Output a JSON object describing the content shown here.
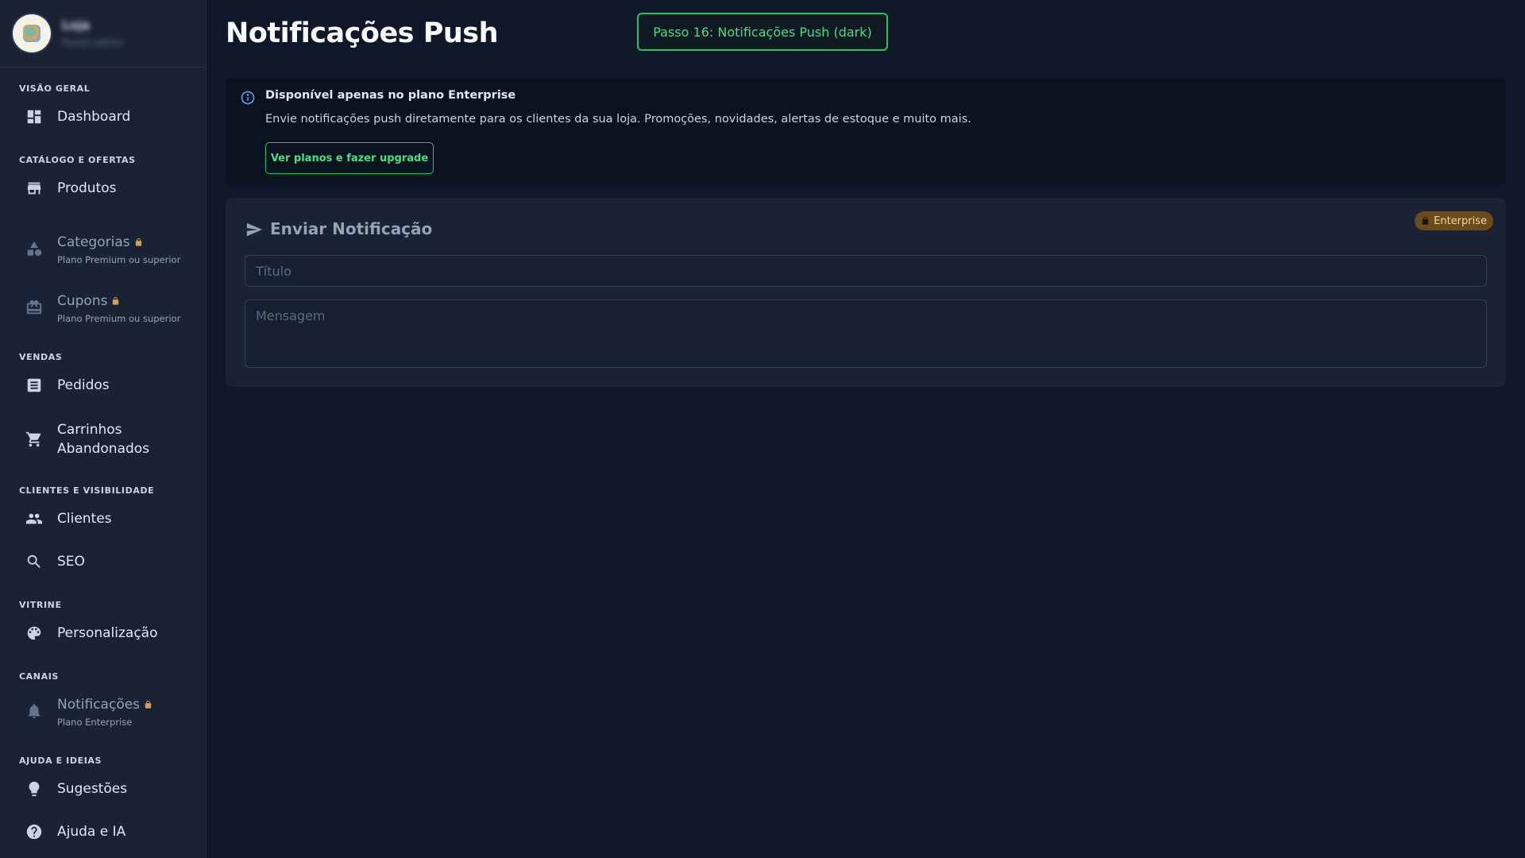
{
  "brand": {
    "name": "Loja",
    "subtitle": "Painel admin"
  },
  "sidebar": {
    "sections": [
      {
        "title": "Visão Geral",
        "items": [
          {
            "label": "Dashboard",
            "icon": "dashboard-icon"
          }
        ]
      },
      {
        "title": "Catálogo e Ofertas",
        "items": [
          {
            "label": "Produtos",
            "icon": "archive-box-icon"
          },
          {
            "label": "Categorias",
            "icon": "category-shapes-icon",
            "locked": true,
            "sub": "Plano Premium ou superior"
          },
          {
            "label": "Cupons",
            "icon": "gift-card-icon",
            "locked": true,
            "sub": "Plano Premium ou superior"
          }
        ]
      },
      {
        "title": "Vendas",
        "items": [
          {
            "label": "Pedidos",
            "icon": "receipt-list-icon"
          },
          {
            "label": "Carrinhos Abandonados",
            "label_line1": "Carrinhos",
            "label_line2": "Abandonados",
            "icon": "shopping-cart-icon"
          }
        ]
      },
      {
        "title": "Clientes e Visibilidade",
        "items": [
          {
            "label": "Clientes",
            "icon": "people-icon"
          },
          {
            "label": "SEO",
            "icon": "search-icon"
          }
        ]
      },
      {
        "title": "Vitrine",
        "items": [
          {
            "label": "Personalização",
            "icon": "palette-icon"
          }
        ]
      },
      {
        "title": "Canais",
        "items": [
          {
            "label": "Notificações",
            "icon": "bell-icon",
            "locked": true,
            "sub": "Plano Enterprise"
          }
        ]
      },
      {
        "title": "Ajuda e Ideias",
        "items": [
          {
            "label": "Sugestões",
            "icon": "lightbulb-icon"
          },
          {
            "label": "Ajuda e IA",
            "icon": "help-circle-icon"
          }
        ]
      }
    ]
  },
  "page": {
    "title": "Notificações Push",
    "step_badge": "Passo 16: Notificações Push (dark)"
  },
  "info": {
    "icon": "info-circle-icon",
    "title": "Disponível apenas no plano Enterprise",
    "text": "Envie notificações push diretamente para os clientes da sua loja. Promoções, novidades, alertas de estoque e muito mais.",
    "button": "Ver planos e fazer upgrade"
  },
  "send": {
    "icon": "send-icon",
    "title": "Enviar Notificação",
    "badge": "Enterprise",
    "title_placeholder": "Título",
    "title_value": "",
    "message_placeholder": "Mensagem",
    "message_value": ""
  },
  "colors": {
    "background": "#0f172a",
    "sidebar": "#1a2335",
    "accent_green": "#22c55e",
    "info_blue": "#60a5fa",
    "lock_amber": "#d4a04a",
    "enterprise_badge": "#6b4a1c"
  }
}
